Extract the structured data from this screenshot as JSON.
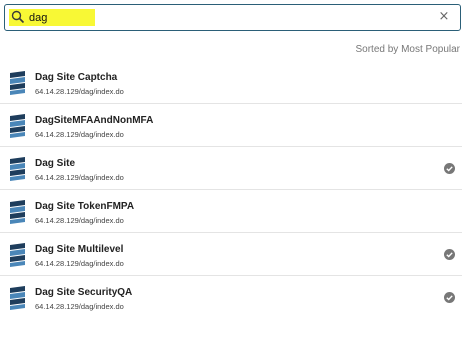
{
  "search": {
    "value": "dag",
    "clear_symbol": "×"
  },
  "sort_label": "Sorted by Most Popular",
  "results": [
    {
      "title": "Dag Site Captcha",
      "url": "64.14.28.129/dag/index.do",
      "selected": false
    },
    {
      "title": "DagSiteMFAAndNonMFA",
      "url": "64.14.28.129/dag/index.do",
      "selected": false
    },
    {
      "title": "Dag Site",
      "url": "64.14.28.129/dag/index.do",
      "selected": true
    },
    {
      "title": "Dag Site TokenFMPA",
      "url": "64.14.28.129/dag/index.do",
      "selected": false
    },
    {
      "title": "Dag Site Multilevel",
      "url": "64.14.28.129/dag/index.do",
      "selected": true
    },
    {
      "title": "Dag Site SecurityQA",
      "url": "64.14.28.129/dag/index.do",
      "selected": true
    }
  ],
  "colors": {
    "highlight": "#f8f835",
    "border": "#2b5f78",
    "icon_dark": "#1e3d5c",
    "icon_light": "#4a86b8",
    "check": "#777777"
  }
}
